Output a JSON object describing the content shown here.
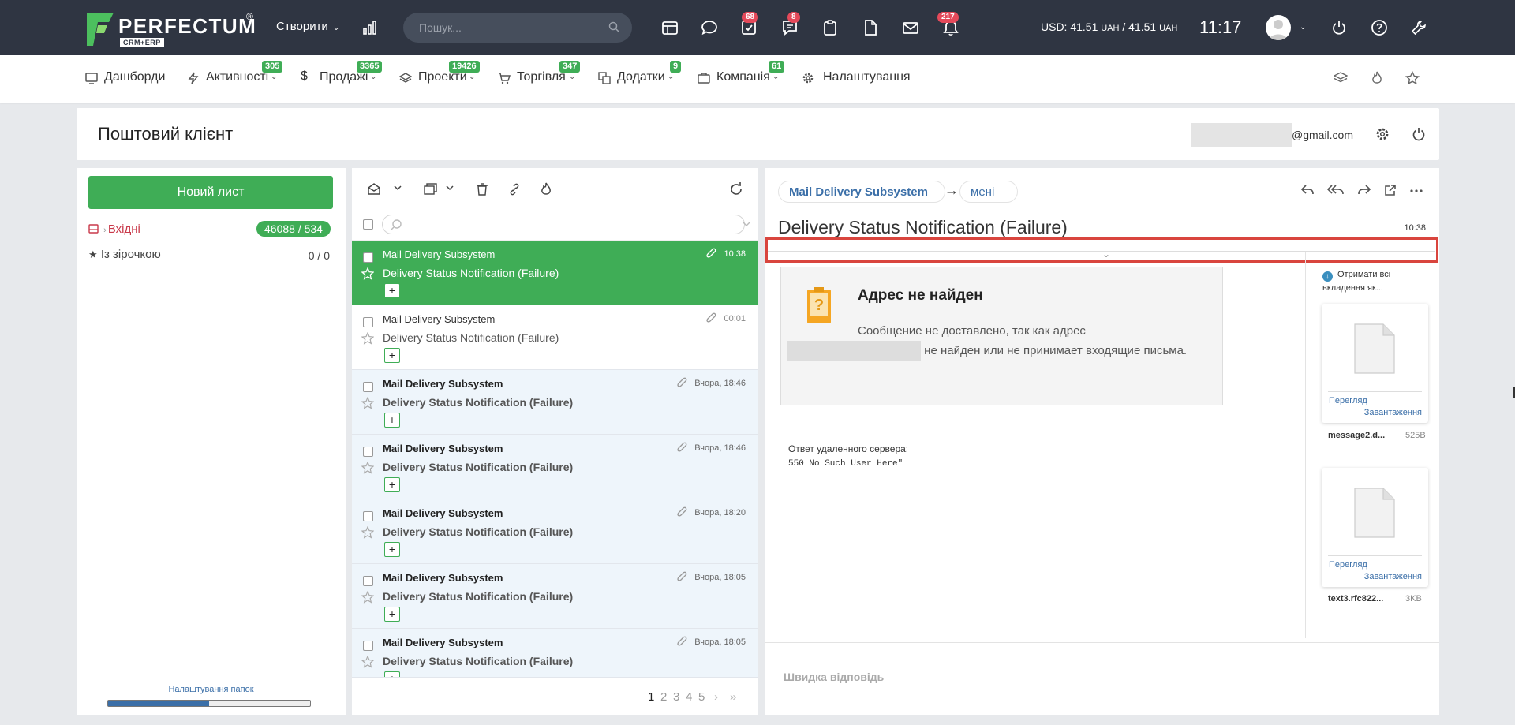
{
  "brand": {
    "name": "PERFECTUM",
    "reg": "®",
    "sub": "CRM+ERP"
  },
  "topbar": {
    "create_label": "Створити",
    "search_placeholder": "Пошук...",
    "badges": {
      "tasks": "68",
      "chat": "8",
      "notifications": "217"
    },
    "currency": {
      "prefix": "USD: 41.51",
      "unit1": "UAH",
      "sep": " / 41.51",
      "unit2": "UAH"
    },
    "clock": "11:17"
  },
  "nav": {
    "items": [
      {
        "label": "Дашборди",
        "badge": ""
      },
      {
        "label": "Активності",
        "badge": "305"
      },
      {
        "label": "Продажі",
        "badge": "3365"
      },
      {
        "label": "Проекти",
        "badge": "19426"
      },
      {
        "label": "Торгівля",
        "badge": "347"
      },
      {
        "label": "Додатки",
        "badge": "9"
      },
      {
        "label": "Компанія",
        "badge": "61"
      },
      {
        "label": "Налаштування",
        "badge": ""
      }
    ]
  },
  "header": {
    "title": "Поштовий клієнт",
    "email_domain": "@gmail.com"
  },
  "sidebar": {
    "new_mail": "Новий лист",
    "folders": [
      {
        "label": "Вхідні",
        "count": "46088 / 534"
      },
      {
        "label": "Із зірочкою",
        "count": "0 / 0"
      }
    ],
    "settings_link": "Налаштування папок",
    "progress": 0.5
  },
  "messages": [
    {
      "sender": "Mail Delivery Subsystem",
      "subject": "Delivery Status Notification (Failure)",
      "time": "10:38",
      "plus": "+"
    },
    {
      "sender": "Mail Delivery Subsystem",
      "subject": "Delivery Status Notification (Failure)",
      "time": "00:01",
      "plus": "+"
    },
    {
      "sender": "Mail Delivery Subsystem",
      "subject": "Delivery Status Notification (Failure)",
      "time": "Вчора, 18:46",
      "plus": "+"
    },
    {
      "sender": "Mail Delivery Subsystem",
      "subject": "Delivery Status Notification (Failure)",
      "time": "Вчора, 18:46",
      "plus": "+"
    },
    {
      "sender": "Mail Delivery Subsystem",
      "subject": "Delivery Status Notification (Failure)",
      "time": "Вчора, 18:20",
      "plus": "+"
    },
    {
      "sender": "Mail Delivery Subsystem",
      "subject": "Delivery Status Notification (Failure)",
      "time": "Вчора, 18:05",
      "plus": "+"
    },
    {
      "sender": "Mail Delivery Subsystem",
      "subject": "Delivery Status Notification (Failure)",
      "time": "Вчора, 18:05",
      "plus": "+"
    }
  ],
  "pagination": {
    "current": "1",
    "pages": [
      "2",
      "3",
      "4",
      "5"
    ],
    "next": "›",
    "last": "»"
  },
  "reader": {
    "from": "Mail Delivery Subsystem",
    "arrow": "→",
    "to": "мені",
    "subject": "Delivery Status Notification (Failure)",
    "time": "10:38",
    "notice_title": "Адрес не найден",
    "notice_text_1": "Сообщение не доставлено, так как адрес",
    "notice_text_2": "не найден или не принимает входящие письма.",
    "server_label": "Ответ удаленного сервера:",
    "server_msg": "550 No Such User Here\"",
    "get_all": "Отримати всі вкладення як...",
    "attachments": [
      {
        "name": "message2.d...",
        "size": "525B",
        "view": "Перегляд",
        "download": "Завантаження"
      },
      {
        "name": "text3.rfc822...",
        "size": "3KB",
        "view": "Перегляд",
        "download": "Завантаження"
      }
    ],
    "quick_reply": "Швидка відповідь"
  }
}
